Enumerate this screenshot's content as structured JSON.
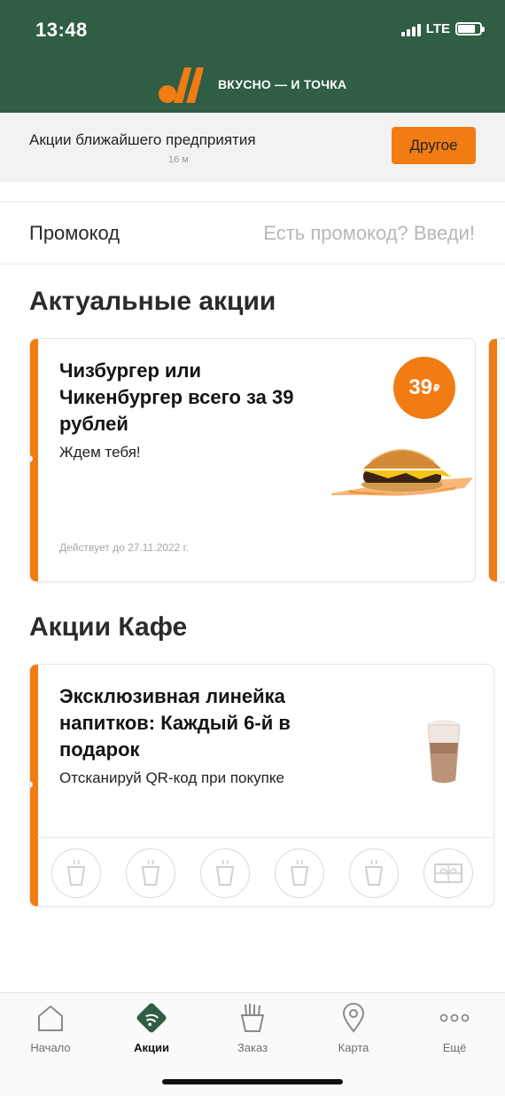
{
  "status_bar": {
    "time": "13:48",
    "network": "LTE"
  },
  "brand": {
    "name": "ВКУСНО — И ТОЧКА",
    "accent_color": "#f07c13",
    "header_color": "#2f5e45"
  },
  "store": {
    "title": "Акции ближайшего предприятия",
    "distance": "16 м",
    "other_button": "Другое"
  },
  "promo": {
    "label": "Промокод",
    "placeholder": "Есть промокод? Введи!"
  },
  "current_promotions": {
    "title": "Актуальные акции",
    "cards": [
      {
        "title_lines": [
          "Чизбургер или",
          "Чикенбургер всего за 39",
          "рублей"
        ],
        "subtitle": "Ждем тебя!",
        "valid_until": "Действует до 27.11.2022 г.",
        "price": "39",
        "currency": "₽",
        "image": "burger-image"
      }
    ]
  },
  "cafe_promotions": {
    "title": "Акции Кафе",
    "card": {
      "title_lines": [
        "Эксклюзивная линейка",
        "напитков: Каждый 6-й в",
        "подарок"
      ],
      "subtitle": "Отсканируй QR-код при покупке",
      "image": "coffee-cup-image",
      "stamps": [
        "coffee-cup-icon",
        "coffee-cup-icon",
        "coffee-cup-icon",
        "coffee-cup-icon",
        "coffee-cup-icon",
        "gift-icon"
      ]
    }
  },
  "nav": {
    "items": [
      {
        "label": "Начало",
        "icon": "home-icon",
        "active": false
      },
      {
        "label": "Акции",
        "icon": "promo-icon",
        "active": true
      },
      {
        "label": "Заказ",
        "icon": "fries-icon",
        "active": false
      },
      {
        "label": "Карта",
        "icon": "map-pin-icon",
        "active": false
      },
      {
        "label": "Ещё",
        "icon": "more-icon",
        "active": false
      }
    ]
  }
}
